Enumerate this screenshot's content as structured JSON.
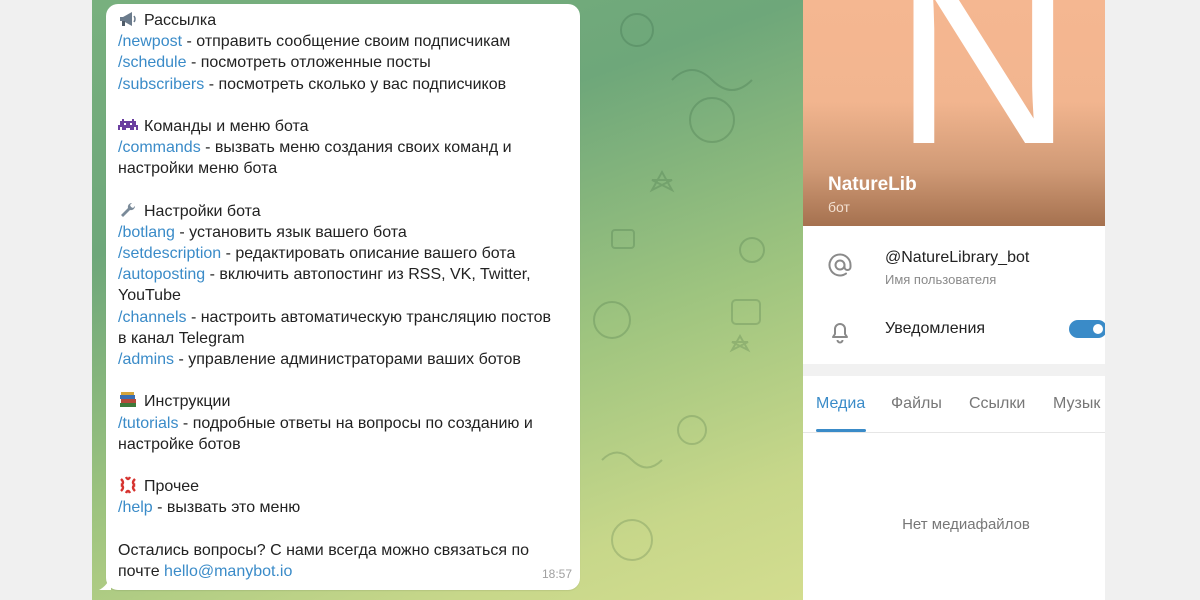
{
  "message": {
    "lines": [
      {
        "emoji": "megaphone-icon",
        "text": "Рассылка"
      },
      {
        "cmd": "/newpost",
        "text": " - отправить сообщение своим подписчикам"
      },
      {
        "cmd": "/schedule",
        "text": " - посмотреть отложенные посты"
      },
      {
        "cmd": "/subscribers",
        "text": " - посмотреть сколько у вас подписчиков"
      },
      {
        "gap": true
      },
      {
        "emoji": "space-invader-icon",
        "text": "Команды и меню бота"
      },
      {
        "cmd": "/commands",
        "text": " - вызвать меню создания своих команд и"
      },
      {
        "text": "настройки меню бота"
      },
      {
        "gap": true
      },
      {
        "emoji": "wrench-icon",
        "text": "Настройки бота"
      },
      {
        "cmd": "/botlang",
        "text": " - установить язык вашего бота"
      },
      {
        "cmd": "/setdescription",
        "text": " - редактировать описание вашего бота"
      },
      {
        "cmd": "/autoposting",
        "text": " - включить автопостинг из RSS, VK, Twitter,"
      },
      {
        "text": "YouTube"
      },
      {
        "cmd": "/channels",
        "text": " - настроить автоматическую трансляцию постов"
      },
      {
        "text": "в канал Telegram"
      },
      {
        "cmd": "/admins",
        "text": " - управление администраторами ваших ботов"
      },
      {
        "gap": true
      },
      {
        "emoji": "books-icon",
        "text": "Инструкции"
      },
      {
        "cmd": "/tutorials",
        "text": " - подробные ответы на вопросы по созданию и"
      },
      {
        "text": "настройке ботов"
      },
      {
        "gap": true
      },
      {
        "emoji": "anger-icon",
        "text": "Прочее"
      },
      {
        "cmd": "/help",
        "text": " - вызвать это меню"
      },
      {
        "gap": true
      },
      {
        "text": "Остались вопросы? С нами всегда можно связаться по"
      },
      {
        "text": "почте ",
        "mail": "hello@manybot.io"
      }
    ],
    "time": "18:57"
  },
  "profile": {
    "avatar_letter": "N",
    "name": "NatureLib",
    "subtitle": "бот",
    "username": "@NatureLibrary_bot",
    "username_label": "Имя пользователя",
    "notifications_label": "Уведомления",
    "notifications_on": true
  },
  "tabs": [
    {
      "label": "Медиа",
      "active": true
    },
    {
      "label": "Файлы",
      "active": false
    },
    {
      "label": "Ссылки",
      "active": false
    },
    {
      "label": "Музык",
      "active": false
    }
  ],
  "empty_state": "Нет медиафайлов",
  "colors": {
    "link": "#3a8bc8",
    "avatar_top": "#f5b791",
    "avatar_bottom": "#a5714f"
  }
}
